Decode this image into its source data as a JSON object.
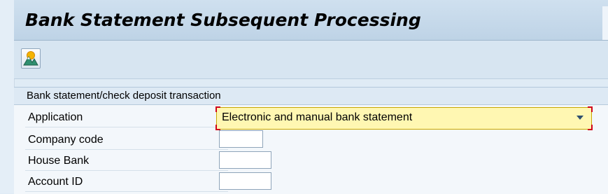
{
  "page": {
    "title": "Bank Statement Subsequent Processing"
  },
  "toolbar": {
    "execute_icon": "execute-icon"
  },
  "panel": {
    "header": "Bank statement/check deposit transaction",
    "fields": [
      {
        "label": "Application",
        "value": "Electronic and manual bank statement",
        "type": "dropdown",
        "required": true
      },
      {
        "label": "Company code",
        "value": "",
        "type": "text"
      },
      {
        "label": "House Bank",
        "value": "",
        "type": "text"
      },
      {
        "label": "Account ID",
        "value": "",
        "type": "text"
      }
    ]
  },
  "colors": {
    "title_bar": "#c6d9ea",
    "panel_header": "#dde9f4",
    "required_field_bg": "#fff7b2",
    "required_marker": "#d0021b"
  }
}
